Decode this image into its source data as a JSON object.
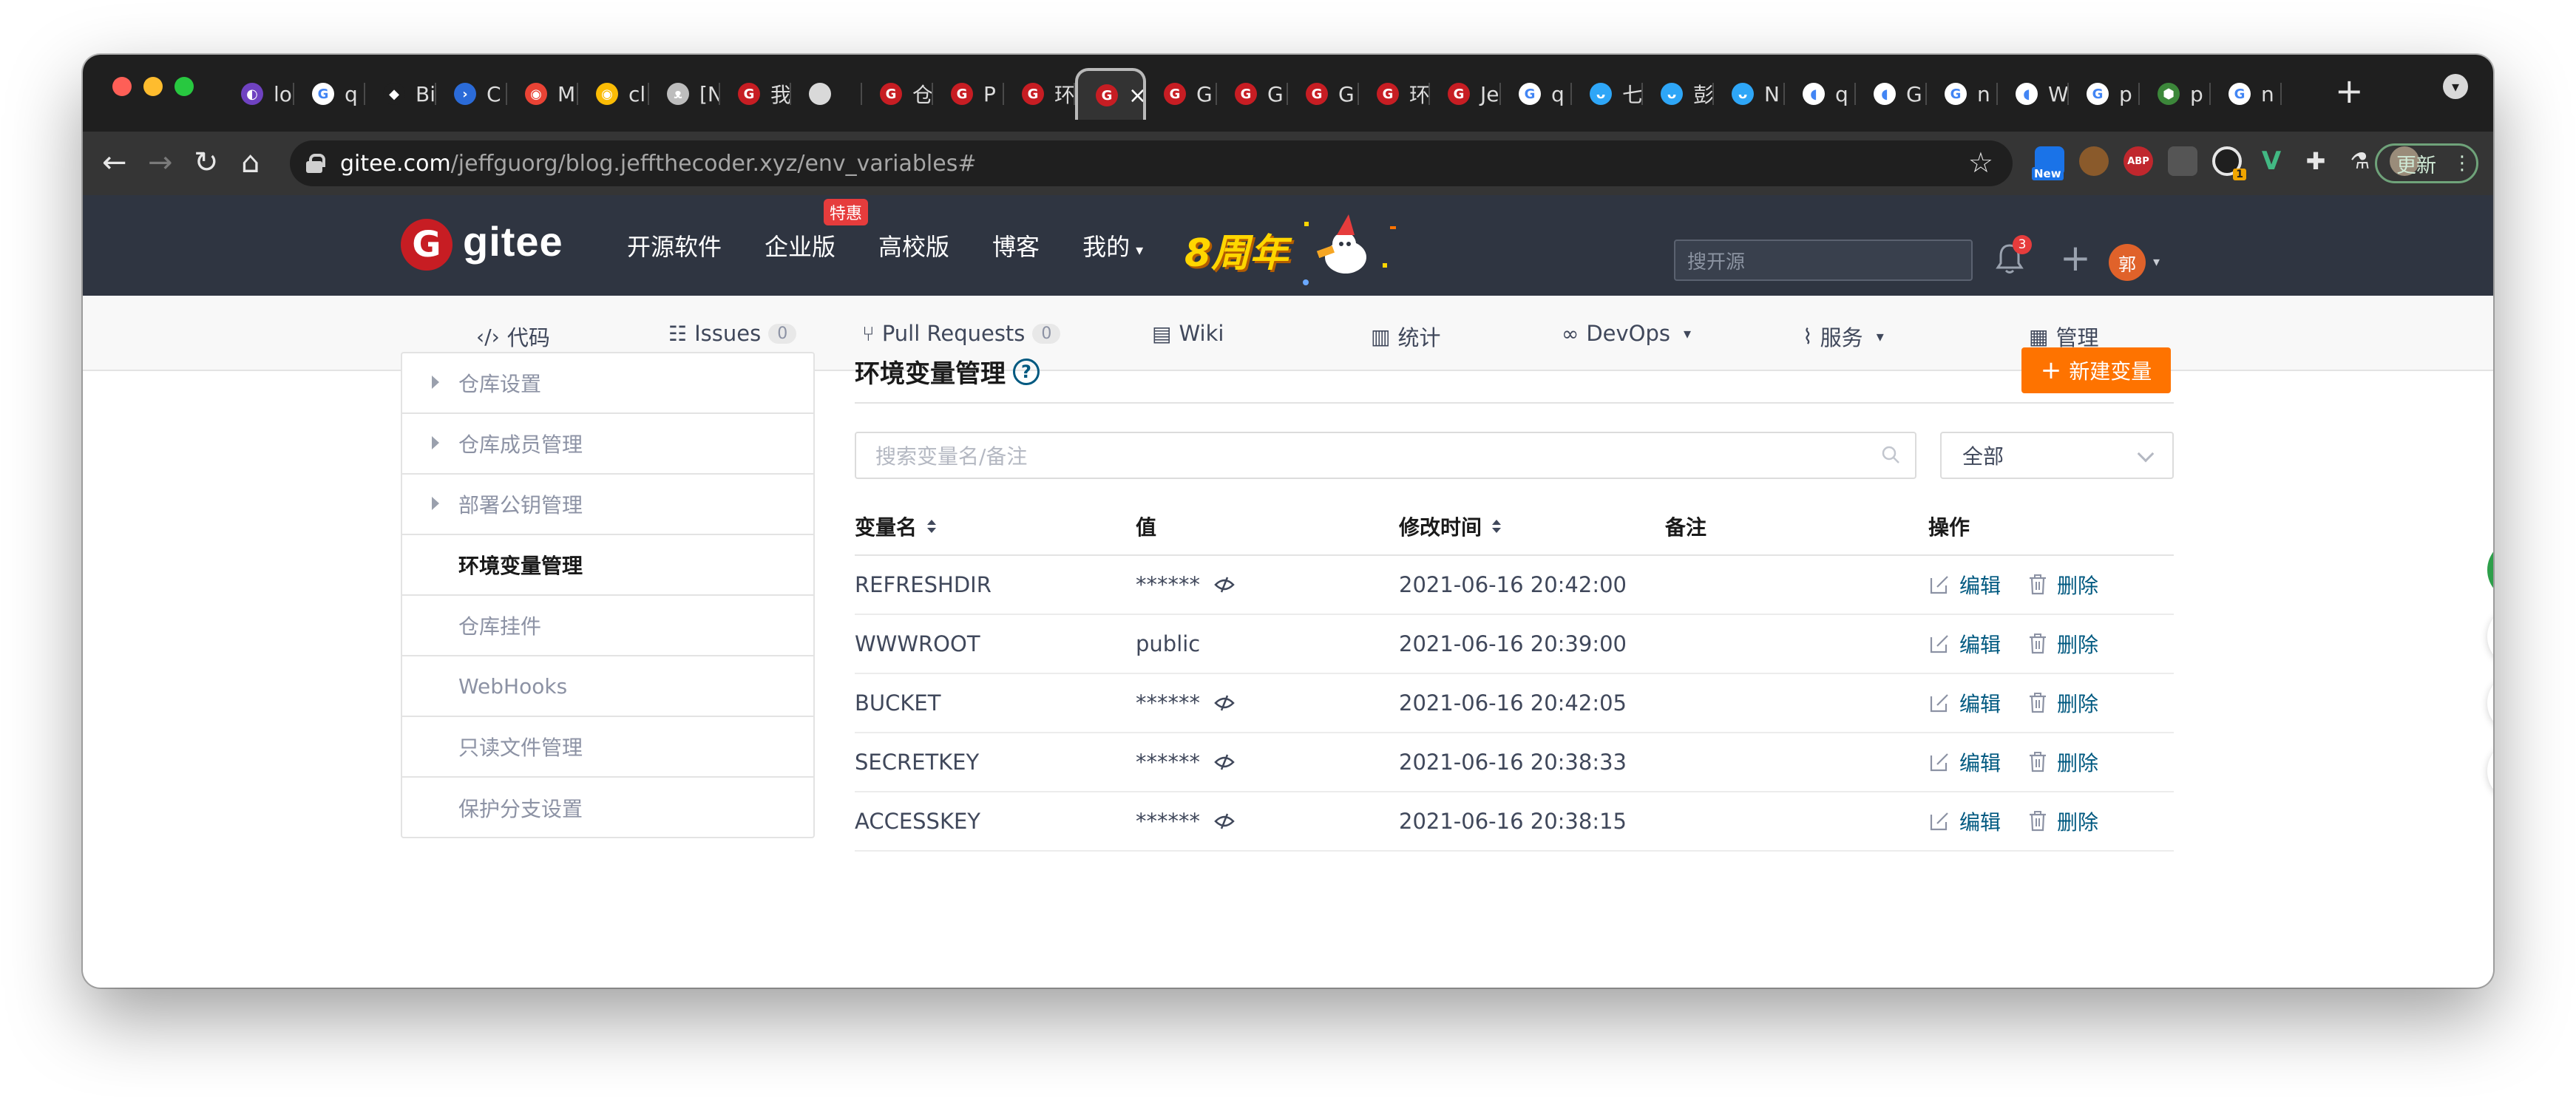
{
  "browser": {
    "tabs": [
      {
        "label": "lo",
        "fav_color": "#6f42c1",
        "fav_glyph": "◐"
      },
      {
        "label": "q",
        "fav_color": "#ffffff",
        "fav_glyph": "G"
      },
      {
        "label": "Bi",
        "fav_color": "#1f1f1f",
        "fav_glyph": "◆"
      },
      {
        "label": "C",
        "fav_color": "#2b6bd8",
        "fav_glyph": "›"
      },
      {
        "label": "M",
        "fav_color": "#ea4335",
        "fav_glyph": "◉"
      },
      {
        "label": "cl",
        "fav_color": "#fbbc05",
        "fav_glyph": "◉"
      },
      {
        "label": "[N",
        "fav_color": "#bdbdbd",
        "fav_glyph": "ᴥ"
      },
      {
        "label": "我",
        "fav_color": "#c71d23",
        "fav_glyph": "G"
      },
      {
        "label": "",
        "fav_color": "#d9d9d9",
        "fav_glyph": ""
      },
      {
        "label": "仓",
        "fav_color": "#c71d23",
        "fav_glyph": "G"
      },
      {
        "label": "P",
        "fav_color": "#c71d23",
        "fav_glyph": "G"
      },
      {
        "label": "环",
        "fav_color": "#c71d23",
        "fav_glyph": "G"
      },
      {
        "label": "",
        "fav_color": "#c71d23",
        "fav_glyph": "G",
        "active": true
      },
      {
        "label": "G",
        "fav_color": "#c71d23",
        "fav_glyph": "G"
      },
      {
        "label": "G",
        "fav_color": "#c71d23",
        "fav_glyph": "G"
      },
      {
        "label": "G",
        "fav_color": "#c71d23",
        "fav_glyph": "G"
      },
      {
        "label": "环",
        "fav_color": "#c71d23",
        "fav_glyph": "G"
      },
      {
        "label": "Je",
        "fav_color": "#c71d23",
        "fav_glyph": "G"
      },
      {
        "label": "q",
        "fav_color": "#ffffff",
        "fav_glyph": "G"
      },
      {
        "label": "七",
        "fav_color": "#2ea6f7",
        "fav_glyph": "ᴗ"
      },
      {
        "label": "彭",
        "fav_color": "#2ea6f7",
        "fav_glyph": "ᴗ"
      },
      {
        "label": "N",
        "fav_color": "#2ea6f7",
        "fav_glyph": "ᴗ"
      },
      {
        "label": "q",
        "fav_color": "#ffffff",
        "fav_glyph": "◖"
      },
      {
        "label": "G",
        "fav_color": "#ffffff",
        "fav_glyph": "◖"
      },
      {
        "label": "n",
        "fav_color": "#ffffff",
        "fav_glyph": "G"
      },
      {
        "label": "W",
        "fav_color": "#ffffff",
        "fav_glyph": "◖"
      },
      {
        "label": "p",
        "fav_color": "#ffffff",
        "fav_glyph": "G"
      },
      {
        "label": "p",
        "fav_color": "#3c873a",
        "fav_glyph": "⬢"
      },
      {
        "label": "n",
        "fav_color": "#ffffff",
        "fav_glyph": "G"
      }
    ],
    "new_tab": "+",
    "url_host": "gitee.com",
    "url_path": "/jeffguorg/blog.jeffthecoder.xyz/env_variables#",
    "update_label": "更新",
    "ext_new_label": "New",
    "ext_abp_label": "ABP",
    "ext_badge_count": "1"
  },
  "header": {
    "logo_text": "gitee",
    "nav": [
      {
        "label": "开源软件"
      },
      {
        "label": "企业版",
        "badge": "特惠"
      },
      {
        "label": "高校版"
      },
      {
        "label": "博客"
      },
      {
        "label": "我的"
      }
    ],
    "anniversary": "8周年",
    "search_placeholder": "搜开源",
    "notifications": "3",
    "avatar_initial": "郭"
  },
  "repo_nav": [
    {
      "label": "代码",
      "icon": "code-icon"
    },
    {
      "label": "Issues",
      "count": "0",
      "icon": "issues-icon"
    },
    {
      "label": "Pull Requests",
      "count": "0",
      "icon": "pull-request-icon"
    },
    {
      "label": "Wiki",
      "icon": "wiki-icon"
    },
    {
      "label": "统计",
      "icon": "chart-icon"
    },
    {
      "label": "DevOps",
      "icon": "infinity-icon",
      "caret": true
    },
    {
      "label": "服务",
      "icon": "pulse-icon",
      "caret": true
    },
    {
      "label": "管理",
      "icon": "manage-icon"
    }
  ],
  "sidebar": {
    "items": [
      {
        "label": "仓库设置",
        "expandable": true
      },
      {
        "label": "仓库成员管理",
        "expandable": true
      },
      {
        "label": "部署公钥管理",
        "expandable": true
      },
      {
        "label": "环境变量管理",
        "active": true
      },
      {
        "label": "仓库挂件"
      },
      {
        "label": "WebHooks"
      },
      {
        "label": "只读文件管理"
      },
      {
        "label": "保护分支设置"
      }
    ]
  },
  "main": {
    "title": "环境变量管理",
    "help_glyph": "?",
    "new_button": "新建变量",
    "search_placeholder": "搜索变量名/备注",
    "filter_value": "全部",
    "columns": {
      "name": "变量名",
      "value": "值",
      "modified": "修改时间",
      "note": "备注",
      "ops": "操作"
    },
    "edit_label": "编辑",
    "delete_label": "删除",
    "rows": [
      {
        "name": "REFRESHDIR",
        "value": "******",
        "masked": true,
        "modified": "2021-06-16 20:42:00",
        "note": ""
      },
      {
        "name": "WWWROOT",
        "value": "public",
        "masked": false,
        "modified": "2021-06-16 20:39:00",
        "note": ""
      },
      {
        "name": "BUCKET",
        "value": "******",
        "masked": true,
        "modified": "2021-06-16 20:42:05",
        "note": ""
      },
      {
        "name": "SECRETKEY",
        "value": "******",
        "masked": true,
        "modified": "2021-06-16 20:38:33",
        "note": ""
      },
      {
        "name": "ACCESSKEY",
        "value": "******",
        "masked": true,
        "modified": "2021-06-16 20:38:15",
        "note": ""
      }
    ]
  },
  "colors": {
    "header_bg": "#2f3541",
    "brand_red": "#c71d23",
    "accent_orange": "#fe7300",
    "link_blue": "#005980",
    "help_green": "#2d9f4a"
  }
}
